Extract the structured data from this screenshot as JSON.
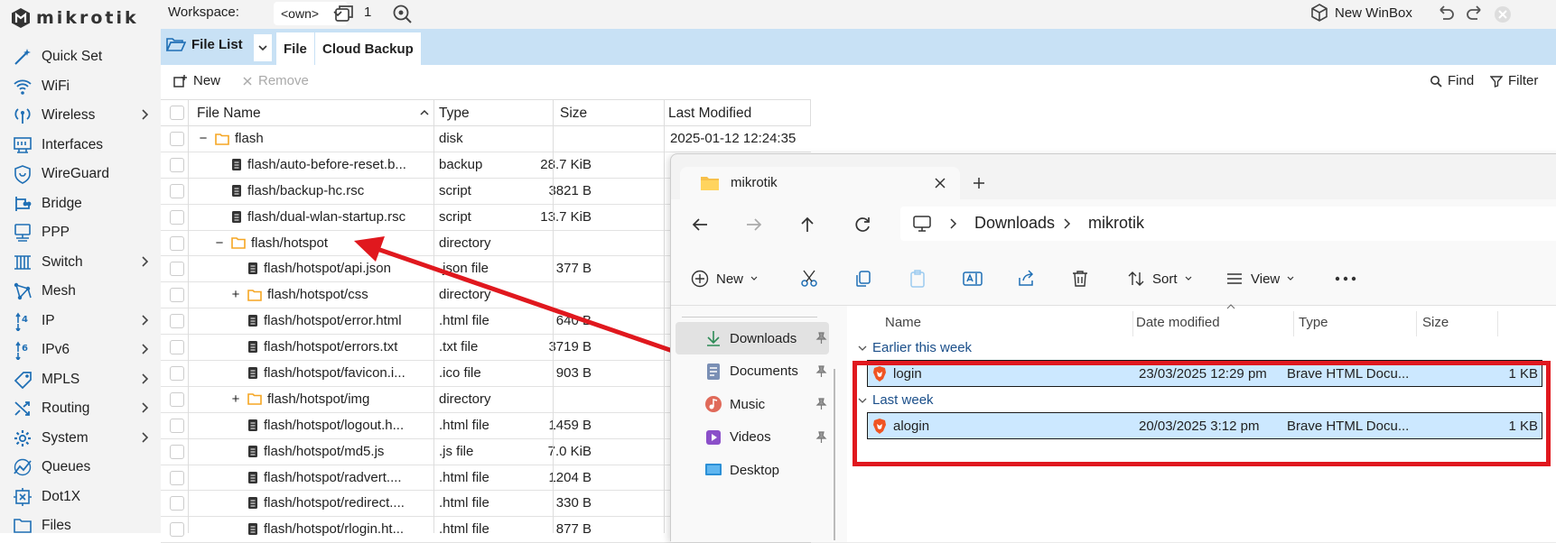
{
  "app": {
    "logo_text": "mikrotik"
  },
  "sidebar": {
    "items": [
      {
        "label": "Quick Set",
        "icon": "wand-icon",
        "chevron": false
      },
      {
        "label": "WiFi",
        "icon": "wifi-icon",
        "chevron": false
      },
      {
        "label": "Wireless",
        "icon": "wireless-icon",
        "chevron": true
      },
      {
        "label": "Interfaces",
        "icon": "interfaces-icon",
        "chevron": false
      },
      {
        "label": "WireGuard",
        "icon": "wireguard-icon",
        "chevron": false
      },
      {
        "label": "Bridge",
        "icon": "bridge-icon",
        "chevron": false
      },
      {
        "label": "PPP",
        "icon": "ppp-icon",
        "chevron": false
      },
      {
        "label": "Switch",
        "icon": "switch-icon",
        "chevron": true
      },
      {
        "label": "Mesh",
        "icon": "mesh-icon",
        "chevron": false
      },
      {
        "label": "IP",
        "icon": "ip-icon",
        "chevron": true
      },
      {
        "label": "IPv6",
        "icon": "ipv6-icon",
        "chevron": true
      },
      {
        "label": "MPLS",
        "icon": "mpls-icon",
        "chevron": true
      },
      {
        "label": "Routing",
        "icon": "routing-icon",
        "chevron": true
      },
      {
        "label": "System",
        "icon": "gear-icon",
        "chevron": true
      },
      {
        "label": "Queues",
        "icon": "queues-icon",
        "chevron": false
      },
      {
        "label": "Dot1X",
        "icon": "dot1x-icon",
        "chevron": false
      },
      {
        "label": "Files",
        "icon": "folder-icon",
        "chevron": false
      }
    ]
  },
  "topbar": {
    "workspace_label": "Workspace:",
    "workspace_value": "<own>",
    "window_count": "1",
    "new_winbox": "New WinBox"
  },
  "tabs": {
    "file_list": "File List",
    "file": "File",
    "cloud_backup": "Cloud Backup"
  },
  "toolbar": {
    "new": "New",
    "remove": "Remove",
    "find": "Find",
    "filter": "Filter"
  },
  "table": {
    "headers": {
      "name": "File Name",
      "type": "Type",
      "size": "Size",
      "modified": "Last Modified"
    },
    "rows": [
      {
        "expander": "−",
        "folder": true,
        "indent": 0,
        "name": "flash",
        "type": "disk",
        "size": "",
        "modified": "2025-01-12 12:24:35"
      },
      {
        "expander": "",
        "folder": false,
        "indent": 1,
        "name": "flash/auto-before-reset.b...",
        "type": "backup",
        "size": "28.7 KiB",
        "modified": ""
      },
      {
        "expander": "",
        "folder": false,
        "indent": 1,
        "name": "flash/backup-hc.rsc",
        "type": "script",
        "size": "3821 B",
        "modified": ""
      },
      {
        "expander": "",
        "folder": false,
        "indent": 1,
        "name": "flash/dual-wlan-startup.rsc",
        "type": "script",
        "size": "13.7 KiB",
        "modified": ""
      },
      {
        "expander": "−",
        "folder": true,
        "indent": 1,
        "name": "flash/hotspot",
        "type": "directory",
        "size": "",
        "modified": ""
      },
      {
        "expander": "",
        "folder": false,
        "indent": 2,
        "name": "flash/hotspot/api.json",
        "type": ".json file",
        "size": "377 B",
        "modified": ""
      },
      {
        "expander": "+",
        "folder": true,
        "indent": 2,
        "name": "flash/hotspot/css",
        "type": "directory",
        "size": "",
        "modified": ""
      },
      {
        "expander": "",
        "folder": false,
        "indent": 2,
        "name": "flash/hotspot/error.html",
        "type": ".html file",
        "size": "640 B",
        "modified": ""
      },
      {
        "expander": "",
        "folder": false,
        "indent": 2,
        "name": "flash/hotspot/errors.txt",
        "type": ".txt file",
        "size": "3719 B",
        "modified": ""
      },
      {
        "expander": "",
        "folder": false,
        "indent": 2,
        "name": "flash/hotspot/favicon.i...",
        "type": ".ico file",
        "size": "903 B",
        "modified": ""
      },
      {
        "expander": "+",
        "folder": true,
        "indent": 2,
        "name": "flash/hotspot/img",
        "type": "directory",
        "size": "",
        "modified": ""
      },
      {
        "expander": "",
        "folder": false,
        "indent": 2,
        "name": "flash/hotspot/logout.h...",
        "type": ".html file",
        "size": "1459 B",
        "modified": ""
      },
      {
        "expander": "",
        "folder": false,
        "indent": 2,
        "name": "flash/hotspot/md5.js",
        "type": ".js file",
        "size": "7.0 KiB",
        "modified": ""
      },
      {
        "expander": "",
        "folder": false,
        "indent": 2,
        "name": "flash/hotspot/radvert....",
        "type": ".html file",
        "size": "1204 B",
        "modified": ""
      },
      {
        "expander": "",
        "folder": false,
        "indent": 2,
        "name": "flash/hotspot/redirect....",
        "type": ".html file",
        "size": "330 B",
        "modified": ""
      },
      {
        "expander": "",
        "folder": false,
        "indent": 2,
        "name": "flash/hotspot/rlogin.ht...",
        "type": ".html file",
        "size": "877 B",
        "modified": ""
      }
    ]
  },
  "explorer": {
    "tab_title": "mikrotik",
    "breadcrumb": [
      "Downloads",
      "mikrotik"
    ],
    "cmd": {
      "new": "New",
      "sort": "Sort",
      "view": "View"
    },
    "nav": [
      "Downloads",
      "Documents",
      "Music",
      "Videos",
      "Desktop"
    ],
    "columns": {
      "name": "Name",
      "date": "Date modified",
      "type": "Type",
      "size": "Size"
    },
    "groups": [
      {
        "label": "Earlier this week",
        "files": [
          {
            "name": "login",
            "date": "23/03/2025 12:29 pm",
            "type": "Brave HTML Docu...",
            "size": "1 KB"
          }
        ]
      },
      {
        "label": "Last week",
        "files": [
          {
            "name": "alogin",
            "date": "20/03/2025 3:12 pm",
            "type": "Brave HTML Docu...",
            "size": "1 KB"
          }
        ]
      }
    ]
  },
  "colors": {
    "accent": "#c8e1f5",
    "highlight": "#e0181e",
    "selection": "#cce8ff",
    "folder": "#f5a623"
  }
}
